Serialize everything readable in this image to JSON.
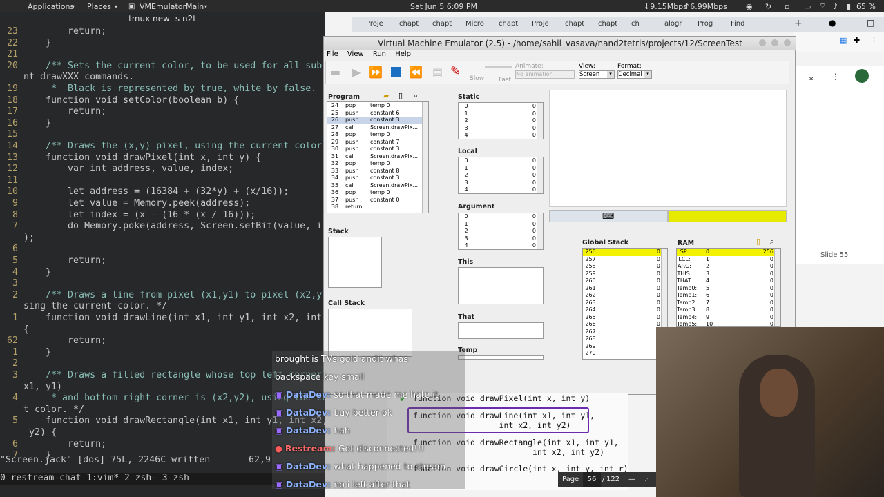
{
  "panel": {
    "applications": "Applications",
    "places": "Places",
    "active_app": "VMEmulatorMain",
    "datetime": "Sat Jun 5  6:09 PM",
    "net_down": "↓9.15Mbps",
    "net_up": "↑6.99Mbps",
    "battery": "65 %"
  },
  "terminal": {
    "title": "tmux new -s n2t",
    "lines": [
      {
        "n": "23",
        "t": "        return;"
      },
      {
        "n": "22",
        "t": "    }"
      },
      {
        "n": "21",
        "t": ""
      },
      {
        "n": "20",
        "t": "    /** Sets the current color, to be used for all subs"
      },
      {
        "n": "",
        "t": "nt drawXXX commands."
      },
      {
        "n": "19",
        "t": "     *  Black is represented by true, white by false. */"
      },
      {
        "n": "18",
        "t": "    function void setColor(boolean b) {"
      },
      {
        "n": "17",
        "t": "        return;"
      },
      {
        "n": "16",
        "t": "    }"
      },
      {
        "n": "15",
        "t": ""
      },
      {
        "n": "14",
        "t": "    /** Draws the (x,y) pixel, using the current color"
      },
      {
        "n": "13",
        "t": "    function void drawPixel(int x, int y) {"
      },
      {
        "n": "12",
        "t": "        var int address, value, index;"
      },
      {
        "n": "11",
        "t": ""
      },
      {
        "n": "10",
        "t": "        let address = (16384 + (32*y) + (x/16));"
      },
      {
        "n": "9",
        "t": "        let value = Memory.peek(address);"
      },
      {
        "n": "8",
        "t": "        let index = (x - (16 * (x / 16)));"
      },
      {
        "n": "7",
        "t": "        do Memory.poke(address, Screen.setBit(value, i"
      },
      {
        "n": "",
        "t": ");"
      },
      {
        "n": "6",
        "t": ""
      },
      {
        "n": "5",
        "t": "        return;"
      },
      {
        "n": "4",
        "t": "    }"
      },
      {
        "n": "3",
        "t": ""
      },
      {
        "n": "2",
        "t": "    /** Draws a line from pixel (x1,y1) to pixel (x2,y"
      },
      {
        "n": "",
        "t": "sing the current color. */"
      },
      {
        "n": "1",
        "t": "    function void drawLine(int x1, int y1, int x2, int"
      },
      {
        "n": "",
        "t": "{"
      },
      {
        "n": "62",
        "t": "        return;"
      },
      {
        "n": "1",
        "t": "    }"
      },
      {
        "n": "2",
        "t": ""
      },
      {
        "n": "3",
        "t": "    /** Draws a filled rectangle whose top left corner"
      },
      {
        "n": "",
        "t": "x1, y1)"
      },
      {
        "n": "4",
        "t": "     * and bottom right corner is (x2,y2), using the curren"
      },
      {
        "n": "",
        "t": "t color. */"
      },
      {
        "n": "5",
        "t": "    function void drawRectangle(int x1, int y1, int x2, int"
      },
      {
        "n": "",
        "t": " y2) {"
      },
      {
        "n": "6",
        "t": "        return;"
      },
      {
        "n": "7",
        "t": "    }"
      }
    ],
    "status_left": "\"Screen.jack\" [dos] 75L, 2246C written",
    "status_right": "62,9",
    "tmux_bar": " 0 restream-chat   1:vim*   2 zsh-   3 zsh"
  },
  "browser": {
    "tabs": [
      "Proje",
      "chapt",
      "chapt",
      "Micro",
      "chapt",
      "Proje",
      "chapt",
      "chapt",
      "ch",
      "alogr",
      "Prog",
      "Find"
    ],
    "slide_label": "Slide 55",
    "page_label": "Page",
    "page_current": "56",
    "page_total": "122"
  },
  "vm": {
    "title": "Virtual Machine Emulator (2.5) - /home/sahil_vasava/nand2tetris/projects/12/ScreenTest",
    "menu": [
      "File",
      "View",
      "Run",
      "Help"
    ],
    "slow": "Slow",
    "fast": "Fast",
    "animate_label": "Animate:",
    "animate_value": "No animation",
    "view_label": "View:",
    "view_value": "Screen",
    "format_label": "Format:",
    "format_value": "Decimal",
    "program_title": "Program",
    "program": [
      [
        "24",
        "pop",
        "temp 0"
      ],
      [
        "25",
        "push",
        "constant 6"
      ],
      [
        "26",
        "push",
        "constant 3"
      ],
      [
        "27",
        "call",
        "Screen.drawPix..."
      ],
      [
        "28",
        "pop",
        "temp 0"
      ],
      [
        "29",
        "push",
        "constant 7"
      ],
      [
        "30",
        "push",
        "constant 3"
      ],
      [
        "31",
        "call",
        "Screen.drawPix..."
      ],
      [
        "32",
        "pop",
        "temp 0"
      ],
      [
        "33",
        "push",
        "constant 8"
      ],
      [
        "34",
        "push",
        "constant 3"
      ],
      [
        "35",
        "call",
        "Screen.drawPix..."
      ],
      [
        "36",
        "pop",
        "temp 0"
      ],
      [
        "37",
        "push",
        "constant 0"
      ],
      [
        "38",
        "return",
        ""
      ]
    ],
    "stack_title": "Stack",
    "callstack_title": "Call Stack",
    "static_title": "Static",
    "static": [
      [
        "0",
        "0"
      ],
      [
        "1",
        "0"
      ],
      [
        "2",
        "0"
      ],
      [
        "3",
        "0"
      ],
      [
        "4",
        "0"
      ]
    ],
    "local_title": "Local",
    "local": [
      [
        "0",
        "0"
      ],
      [
        "1",
        "0"
      ],
      [
        "2",
        "0"
      ],
      [
        "3",
        "0"
      ],
      [
        "4",
        "0"
      ]
    ],
    "argument_title": "Argument",
    "argument": [
      [
        "0",
        "0"
      ],
      [
        "1",
        "0"
      ],
      [
        "2",
        "0"
      ],
      [
        "3",
        "0"
      ],
      [
        "4",
        "0"
      ]
    ],
    "this_title": "This",
    "that_title": "That",
    "temp_title": "Temp",
    "global_stack_title": "Global Stack",
    "global_stack": [
      [
        "256",
        "0"
      ],
      [
        "257",
        "0"
      ],
      [
        "258",
        "0"
      ],
      [
        "259",
        "0"
      ],
      [
        "260",
        "0"
      ],
      [
        "261",
        "0"
      ],
      [
        "262",
        "0"
      ],
      [
        "263",
        "0"
      ],
      [
        "264",
        "0"
      ],
      [
        "265",
        "0"
      ],
      [
        "266",
        "0"
      ],
      [
        "267",
        "0"
      ],
      [
        "268",
        "0"
      ],
      [
        "269",
        "0"
      ],
      [
        "270",
        "0"
      ]
    ],
    "ram_title": "RAM",
    "ram": [
      [
        "SP:",
        "0",
        "256"
      ],
      [
        "LCL:",
        "1",
        "0"
      ],
      [
        "ARG:",
        "2",
        "0"
      ],
      [
        "THIS:",
        "3",
        "0"
      ],
      [
        "THAT:",
        "4",
        "0"
      ],
      [
        "Temp0:",
        "5",
        "0"
      ],
      [
        "Temp1:",
        "6",
        "0"
      ],
      [
        "Temp2:",
        "7",
        "0"
      ],
      [
        "Temp3:",
        "8",
        "0"
      ],
      [
        "Temp4:",
        "9",
        "0"
      ],
      [
        "Temp5:",
        "10",
        "0"
      ]
    ]
  },
  "chat": [
    {
      "user": "",
      "msg": "brought is TVs gold andit whas"
    },
    {
      "user": "",
      "msg": "backspace key small"
    },
    {
      "user": "DataDev",
      "msg": "so that made me hate it"
    },
    {
      "user": "DataDev",
      "msg": "buy better ok"
    },
    {
      "user": "DataDev",
      "msg": "hah"
    },
    {
      "user": "Restream",
      "msg": "Got disconnected!!!"
    },
    {
      "user": "DataDev",
      "msg": "what happened to stream"
    },
    {
      "user": "DataDev",
      "msg": "no i left after that"
    }
  ],
  "slide": {
    "l1": "function void drawPixel(int x, int y)",
    "l2a": "function void drawLine(int x1, int y1,",
    "l2b": "                  int x2, int y2)",
    "l3a": "function void drawRectangle(int x1, int y1,",
    "l3b": "                         int x2, int y2)",
    "l4": "function void drawCircle(int x, int y, int r)"
  }
}
